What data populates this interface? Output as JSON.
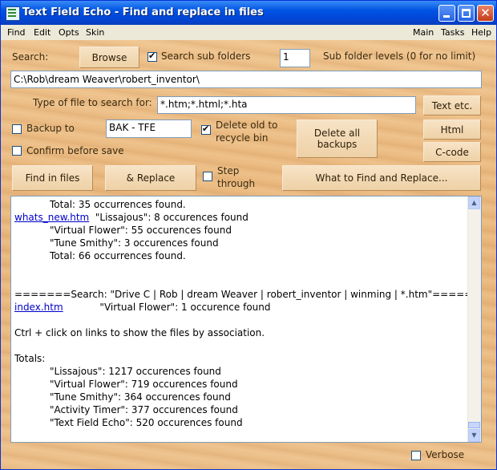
{
  "window": {
    "title": "Text Field Echo - Find and replace in files",
    "close_glyph": "✕"
  },
  "menu": {
    "left": [
      "Find",
      "Edit",
      "Opts",
      "Skin"
    ],
    "right": [
      "Main",
      "Tasks",
      "Help"
    ]
  },
  "search": {
    "label": "Search:",
    "browse": "Browse",
    "subfolders_label": "Search sub folders",
    "subfolders_checked": true,
    "levels_value": "1",
    "levels_label": "Sub folder levels (0 for no limit)",
    "path": "C:\\Rob\\dream Weaver\\robert_inventor\\"
  },
  "filetype": {
    "label": "Type of file to search for:",
    "value": "*.htm;*.html;*.hta",
    "text_btn": "Text etc.",
    "html_btn": "Html",
    "ccode_btn": "C-code"
  },
  "backup": {
    "label": "Backup to",
    "checked": false,
    "value": "BAK - TFE",
    "delete_old_1": "Delete old to",
    "delete_old_2": "recycle bin",
    "delete_old_checked": true,
    "delete_all_1": "Delete all",
    "delete_all_2": "backups",
    "confirm_label": "Confirm before save",
    "confirm_checked": false
  },
  "actions": {
    "find": "Find in files",
    "replace": "& Replace",
    "step_1": "Step",
    "step_2": "through",
    "step_checked": false,
    "what": "What to Find and Replace..."
  },
  "results": [
    {
      "indent": true,
      "text": "Total: 35 occurrences found."
    },
    {
      "link": "whats_new.htm",
      "text": "  \"Lissajous\": 8 occurences found"
    },
    {
      "indent": true,
      "text": "\"Virtual Flower\": 55 occurences found"
    },
    {
      "indent": true,
      "text": "\"Tune Smithy\": 3 occurences found"
    },
    {
      "indent": true,
      "text": "Total: 66 occurrences found."
    },
    {
      "text": ""
    },
    {
      "text": ""
    },
    {
      "text": "=======Search: \"Drive C | Rob | dream Weaver | robert_inventor | winming | *.htm\"======="
    },
    {
      "link": "index.htm",
      "text": "            \"Virtual Flower\": 1 occurence found"
    },
    {
      "text": ""
    },
    {
      "text": "Ctrl + click on links to show the files by association."
    },
    {
      "text": ""
    },
    {
      "text": "Totals:"
    },
    {
      "indent": true,
      "text": "\"Lissajous\": 1217 occurences found"
    },
    {
      "indent": true,
      "text": "\"Virtual Flower\": 719 occurences found"
    },
    {
      "indent": true,
      "text": "\"Tune Smithy\": 364 occurences found"
    },
    {
      "indent": true,
      "text": "\"Activity Timer\": 377 occurences found"
    },
    {
      "indent": true,
      "text": "\"Text Field Echo\": 520 occurences found"
    }
  ],
  "verbose": {
    "label": "Verbose",
    "checked": false
  },
  "scroll": {
    "up": "▲",
    "down": "▼"
  }
}
